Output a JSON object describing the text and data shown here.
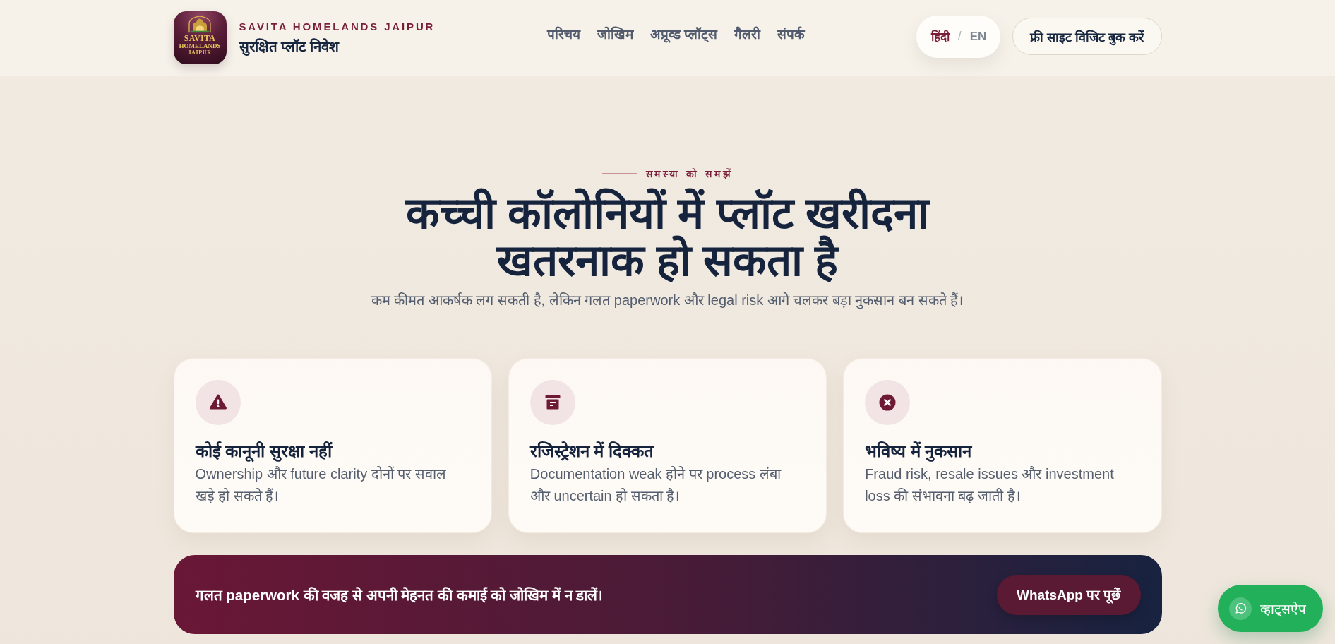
{
  "header": {
    "logo_text": [
      "SAVITA",
      "HOMELANDS",
      "JAIPUR"
    ],
    "brand_name": "SAVITA HOMELANDS JAIPUR",
    "tagline": "सुरक्षित प्लॉट निवेश",
    "nav": [
      "परिचय",
      "जोखिम",
      "अप्रूव्ड प्लॉट्स",
      "गैलरी",
      "संपर्क"
    ],
    "language": [
      {
        "label": "हिंदी",
        "selected": true
      },
      {
        "label": "EN",
        "selected": false
      }
    ],
    "language_separator": "/",
    "cta": "फ्री साइट विजिट बुक करें"
  },
  "hero": {
    "eyebrow": "समस्या को समझें",
    "title": "कच्ची कॉलोनियों में प्लॉट खरीदना खतरनाक हो सकता है",
    "subtitle": "कम कीमत आकर्षक लग सकती है, लेकिन गलत paperwork और legal risk आगे चलकर बड़ा नुकसान बन सकते हैं।"
  },
  "cards": [
    {
      "title": "कोई कानूनी सुरक्षा नहीं",
      "text": "Ownership और future clarity दोनों पर सवाल खड़े हो सकते हैं।"
    },
    {
      "title": "रजिस्ट्रेशन में दिक्कत",
      "text": "Documentation weak होने पर process लंबा और uncertain हो सकता है।"
    },
    {
      "title": "भविष्य में नुकसान",
      "text": "Fraud risk, resale issues और investment loss की संभावना बढ़ जाती है।"
    }
  ],
  "banner": {
    "text": "गलत paperwork की वजह से अपनी मेहनत की कमाई को जोखिम में न डालें।",
    "button": "WhatsApp पर पूछें"
  },
  "floating_button": {
    "label": "व्हाट्सऐप"
  }
}
